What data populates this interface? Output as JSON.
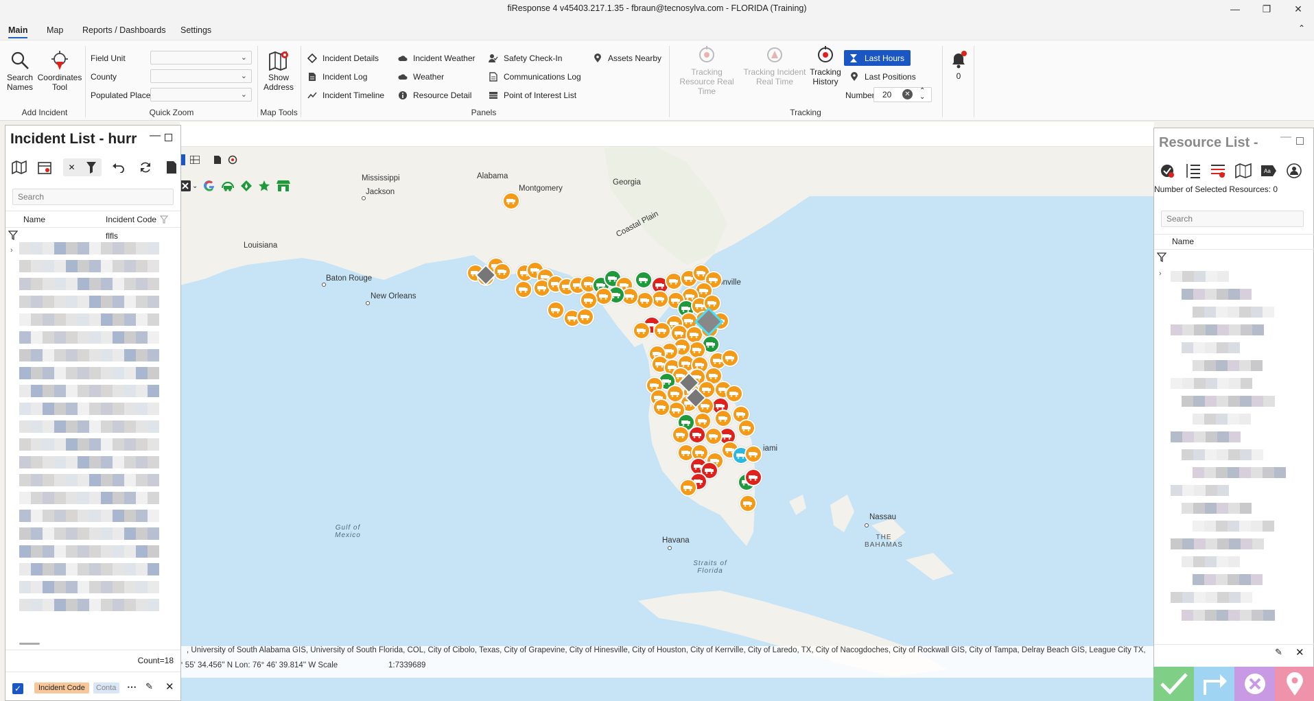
{
  "window": {
    "title": "fiResponse 4 v45403.217.1.35 - fbraun@tecnosylva.com - FLORIDA (Training)"
  },
  "menu": {
    "tabs": [
      "Main",
      "Map",
      "Reports / Dashboards",
      "Settings"
    ]
  },
  "ribbon": {
    "add_incident": {
      "search_names": "Search Names",
      "coordinates_tool": "Coordinates Tool",
      "group": "Add Incident"
    },
    "quick_zoom": {
      "field_unit": "Field Unit",
      "county": "County",
      "populated_place": "Populated Place",
      "group": "Quick Zoom"
    },
    "map_tools": {
      "show_address": "Show Address",
      "group": "Map Tools"
    },
    "panels": {
      "items": [
        "Incident Details",
        "Incident Log",
        "Incident Timeline",
        "Incident Weather",
        "Weather",
        "Resource Detail",
        "Safety Check-In",
        "Communications Log",
        "Point of Interest List",
        "Assets Nearby"
      ],
      "group": "Panels"
    },
    "tracking": {
      "tracking_resource": "Tracking Resource Real Time",
      "tracking_incident": "Tracking Incident Real Time",
      "tracking_history": "Tracking History",
      "last_hours": "Last Hours",
      "last_positions": "Last Positions",
      "number_label": "Number",
      "number_value": "20",
      "group": "Tracking"
    },
    "notifications": {
      "count": "0"
    }
  },
  "incident_panel": {
    "title": "Incident List - hurr",
    "search_placeholder": "Search",
    "col_name": "Name",
    "col_code": "Incident Code",
    "filter_value": "flfls",
    "count": "Count=18",
    "chip_code": "Incident Code",
    "chip_contact": "Conta"
  },
  "resource_panel": {
    "title": "Resource List -",
    "selected": "Number of Selected Resources: 0",
    "search_placeholder": "Search",
    "col_name": "Name"
  },
  "map": {
    "labels": {
      "mississippi": "Mississippi",
      "alabama": "Alabama",
      "georgia": "Georgia",
      "louisiana": "Louisiana",
      "coastal_plain": "Coastal Plain",
      "jackson": "Jackson",
      "montgomery": "Montgomery",
      "baton_rouge": "Baton Rouge",
      "new_orleans": "New Orleans",
      "jacksonville": "cksonville",
      "miami": "iami",
      "nassau": "Nassau",
      "the_bahamas": "THE BAHAMAS",
      "havana": "Havana",
      "gulf": "Gulf of Mexico",
      "straits": "Straits of Florida"
    },
    "attribution": ", University of South Alabama GIS, University of South Florida, COL, City of Cibolo, Texas, City of Grapevine, City of Hinesville, City of Houston, City of Kerrville, City of Laredo, TX, City of Nacogdoches, City of Rockwall GIS, City of Tampa, Delray Beach GIS, League City TX,",
    "coordinates": "° 55' 34.456'' N  Lon: 76° 46' 39.814'' W  Scale",
    "scale": "1:7339689"
  },
  "colors": {
    "accent": "#1a57c5",
    "orange": "#f59a17",
    "green": "#1e9a3b",
    "red": "#e0201b",
    "cyan": "#29b8e0",
    "map_sea": "#c6e4f6",
    "map_land": "#f3f1ec"
  }
}
